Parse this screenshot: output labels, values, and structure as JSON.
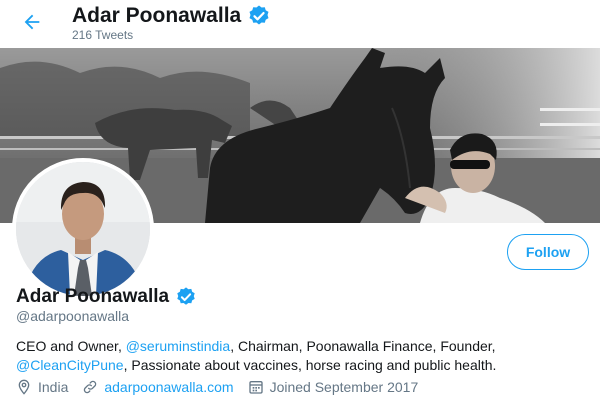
{
  "header": {
    "name": "Adar Poonawalla",
    "tweet_count": "216 Tweets"
  },
  "profile": {
    "name": "Adar Poonawalla",
    "handle": "@adarpoonawalla",
    "follow_label": "Follow",
    "bio": {
      "part1": "CEO and Owner, ",
      "mention1": "@seruminstindia",
      "part2": ", Chairman, Poonawalla Finance, Founder, ",
      "mention2": "@CleanCityPune",
      "part3": ", Passionate about vaccines, horse racing and public health."
    },
    "location": "India",
    "website": "adarpoonawalla.com",
    "joined": "Joined September 2017"
  },
  "icons": {
    "back": "arrow-left-icon",
    "verified": "verified-badge-icon",
    "location": "location-pin-icon",
    "link": "link-icon",
    "calendar": "calendar-icon"
  },
  "colors": {
    "accent": "#1da1f2",
    "secondary_text": "#657786",
    "primary_text": "#14171a"
  }
}
